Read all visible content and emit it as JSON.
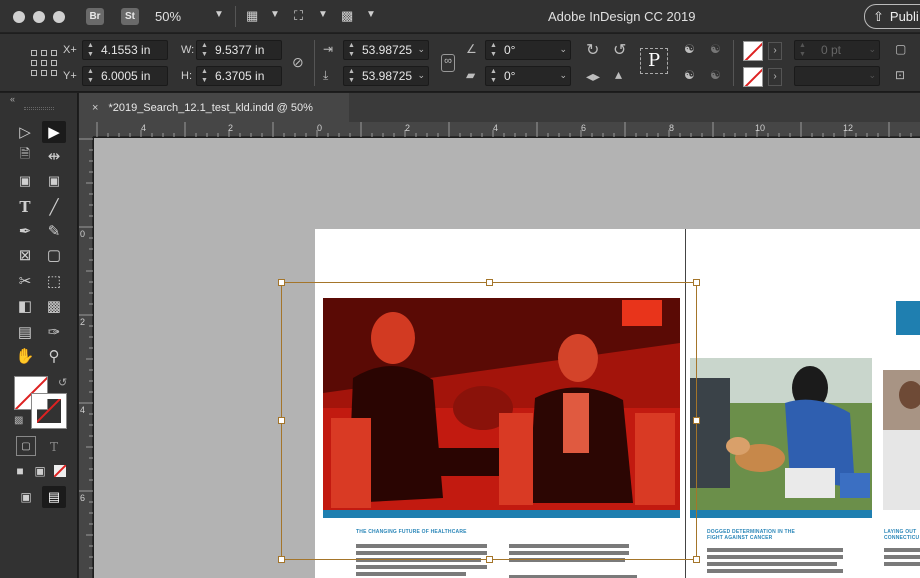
{
  "titlebar": {
    "bridge_badge": "Br",
    "stock_badge": "St",
    "zoom": "50%",
    "app_title": "Adobe InDesign CC 2019",
    "publish_label": "Publi"
  },
  "control": {
    "x_label": "X+",
    "x_value": "4.1553 in",
    "y_label": "Y+",
    "y_value": "6.0005 in",
    "w_label": "W:",
    "w_value": "9.5377 in",
    "h_label": "H:",
    "h_value": "6.3705 in",
    "scale_x": "53.98725",
    "scale_y": "53.98725",
    "rotate": "0°",
    "shear": "0°",
    "stroke_weight": "0 pt"
  },
  "document": {
    "tab_title": "*2019_Search_12.1_test_kld.indd @ 50%"
  },
  "ruler": {
    "h_labels": [
      "4",
      "2",
      "0",
      "2",
      "4",
      "6",
      "8",
      "10",
      "12"
    ],
    "v_labels": [
      "0",
      "2",
      "4",
      "6"
    ]
  },
  "layout": {
    "caption_1": "THE CHANGING FUTURE OF HEALTHCARE",
    "caption_2_line1": "DOGGED DETERMINATION IN THE",
    "caption_2_line2": "FIGHT AGAINST CANCER",
    "caption_3_line1": "LAYING OUT",
    "caption_3_line2": "CONNECTICU"
  },
  "colors": {
    "selection": "#a4752a",
    "accent_blue": "#1f7fb0",
    "photo_red": "#b8160c"
  }
}
